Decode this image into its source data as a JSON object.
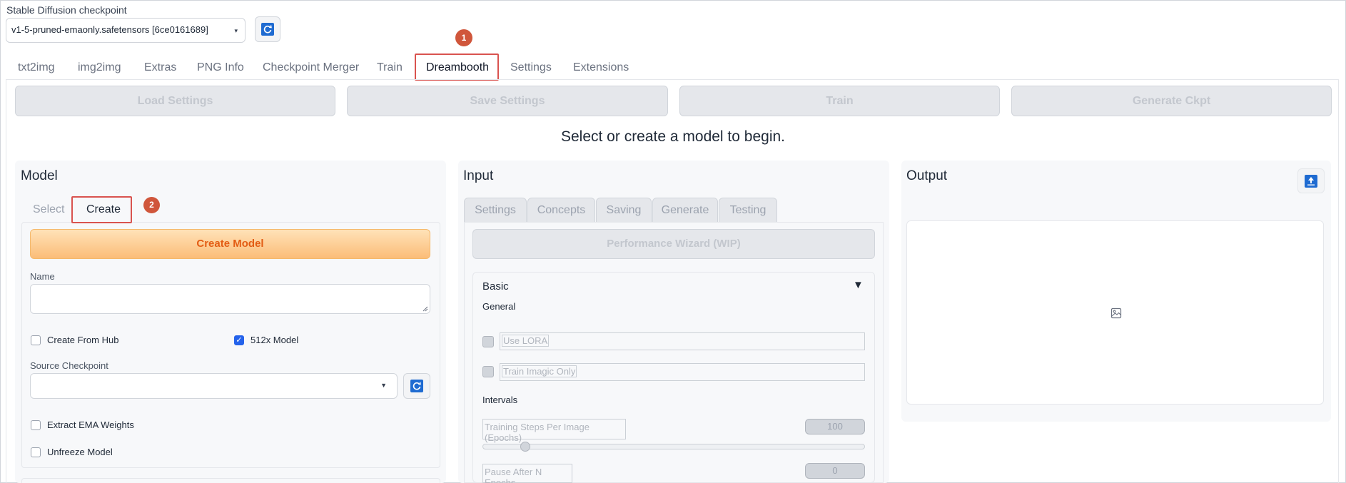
{
  "checkpoint": {
    "label": "Stable Diffusion checkpoint",
    "selected": "v1-5-pruned-emaonly.safetensors [6ce0161689]"
  },
  "tabs": [
    "txt2img",
    "img2img",
    "Extras",
    "PNG Info",
    "Checkpoint Merger",
    "Train",
    "Dreambooth",
    "Settings",
    "Extensions"
  ],
  "annotations": {
    "badge1": "1",
    "badge2": "2"
  },
  "actions": {
    "load": "Load Settings",
    "save": "Save Settings",
    "train": "Train",
    "generate": "Generate Ckpt"
  },
  "status_text": "Select or create a model to begin.",
  "model": {
    "title": "Model",
    "tab_select": "Select",
    "tab_create": "Create",
    "create_button": "Create Model",
    "name_label": "Name",
    "name_value": "",
    "create_from_hub": "Create From Hub",
    "create_from_hub_checked": false,
    "model_512x": "512x Model",
    "model_512x_checked": true,
    "source_checkpoint_label": "Source Checkpoint",
    "source_checkpoint_value": "",
    "extract_ema": "Extract EMA Weights",
    "unfreeze": "Unfreeze Model"
  },
  "input": {
    "title": "Input",
    "tabs": [
      "Settings",
      "Concepts",
      "Saving",
      "Generate",
      "Testing"
    ],
    "perf_wizard": "Performance Wizard (WIP)",
    "basic": "Basic",
    "general": "General",
    "use_lora": "Use LORA",
    "train_imagic": "Train Imagic Only",
    "intervals": "Intervals",
    "training_steps_label": "Training Steps Per Image (Epochs)",
    "training_steps_value": "100",
    "pause_label": "Pause After N Epochs",
    "pause_value": "0"
  },
  "output": {
    "title": "Output"
  },
  "icons": {
    "refresh": "refresh-icon",
    "top": "scroll-top-icon",
    "image_placeholder": "image-icon",
    "collapse": "triangle-down-icon"
  },
  "colors": {
    "accent_orange": "#e35d14",
    "highlight_red": "#d9534f",
    "checkbox_blue": "#2563eb",
    "refresh_blue": "#1f6bd1"
  }
}
